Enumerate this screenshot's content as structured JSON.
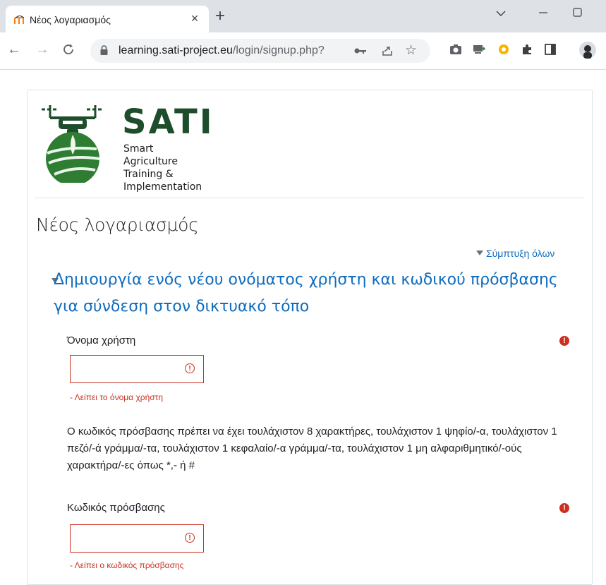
{
  "browser": {
    "tab_title": "Νέος λογαριασμός",
    "tab_close": "×",
    "new_tab": "+",
    "url_host": "learning.sati-project.eu",
    "url_path": "/login/signup.php?"
  },
  "logo": {
    "name": "SATI",
    "tagline": [
      "Smart Agriculture",
      "Training &",
      "Implementation"
    ]
  },
  "page": {
    "title": "Νέος λογαριασμός",
    "collapse_all": "Σύμπτυξη όλων",
    "section_title": "Δημιουργία ενός νέου ονόματος χρήστη και κωδικού πρόσβασης για σύνδεση στον δικτυακό τόπο"
  },
  "form": {
    "username": {
      "label": "Όνομα χρήστη",
      "value": "",
      "error": "- Λείπει το όνομα χρήστη"
    },
    "password_policy": "Ο κωδικός πρόσβασης πρέπει να έχει τουλάχιστον 8 χαρακτήρες, τουλάχιστον 1 ψηφίο/-α, τουλάχιστον 1 πεζό/-ά γράμμα/-τα, τουλάχιστον 1 κεφαλαίο/-α γράμμα/-τα, τουλάχιστον 1 μη αλφαριθμητικό/-ούς χαρακτήρα/-ες όπως *,- ή #",
    "password": {
      "label": "Κωδικός πρόσβασης",
      "value": "",
      "error": "- Λείπει ο κωδικός πρόσβασης"
    }
  },
  "colors": {
    "link": "#0f6cbf",
    "error": "#ca3120",
    "logo_green": "#1e4d2b"
  }
}
